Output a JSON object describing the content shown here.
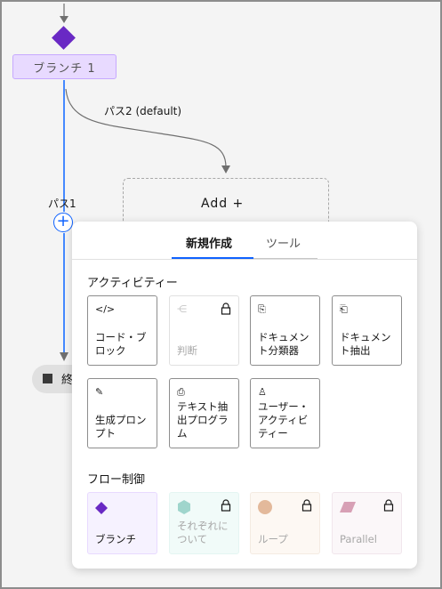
{
  "canvas": {
    "branch_label": "ブランチ 1",
    "path2_label": "パス2 (default)",
    "path1_label": "パス1",
    "add_label": "Add  +",
    "add_plus": "+",
    "end_label": "終"
  },
  "popup": {
    "tabs": [
      {
        "label": "新規作成",
        "active": true
      },
      {
        "label": "ツール",
        "active": false
      }
    ],
    "activities_title": "アクティビティー",
    "activities": [
      {
        "icon": "code-icon",
        "glyph": "</>",
        "label": "コード・ブ\nロック",
        "locked": false
      },
      {
        "icon": "decision-icon",
        "glyph": "⋲",
        "label": "判断",
        "locked": true
      },
      {
        "icon": "document-classifier-icon",
        "glyph": "⎘",
        "label": "ドキュメン\nト分類器",
        "locked": false
      },
      {
        "icon": "document-extract-icon",
        "glyph": "⎗",
        "label": "ドキュメン\nト抽出",
        "locked": false
      },
      {
        "icon": "pen-icon",
        "glyph": "✎",
        "label": "生成プロン\nプト",
        "locked": false
      },
      {
        "icon": "text-extract-icon",
        "glyph": "⎙",
        "label": "テキスト抽\n出プログラ\nム",
        "locked": false
      },
      {
        "icon": "user-icon",
        "glyph": "♙",
        "label": "ユーザー・\nアクティビ\nティー",
        "locked": false
      }
    ],
    "flow_title": "フロー制御",
    "flow": [
      {
        "icon": "diamond-icon",
        "label": "ブランチ",
        "locked": false,
        "color": "#6929c4"
      },
      {
        "icon": "hexagon-icon",
        "label": "それぞれに\nついて",
        "locked": true,
        "color": "#9fd5cc"
      },
      {
        "icon": "circle-icon",
        "label": "ループ",
        "locked": true,
        "color": "#e3b99b"
      },
      {
        "icon": "parallelogram-icon",
        "label": "Parallel",
        "locked": true,
        "color": "#d7a0b5"
      }
    ]
  },
  "colors": {
    "accent": "#0f62fe",
    "branch": "#6929c4"
  }
}
